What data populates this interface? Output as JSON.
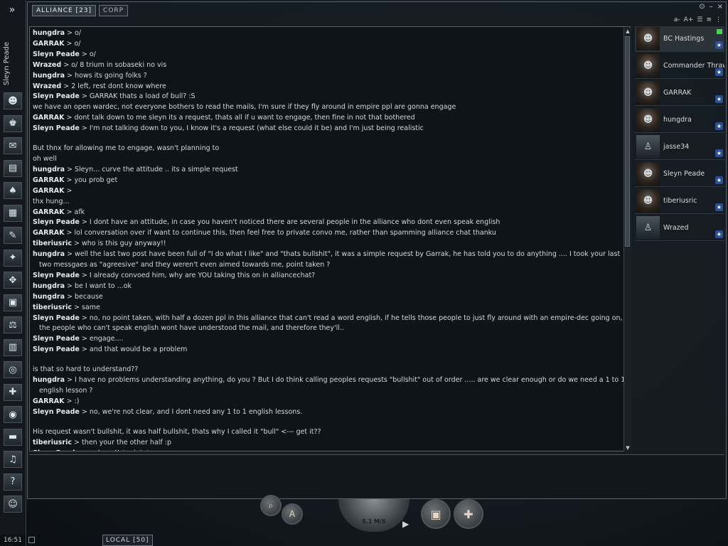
{
  "neocom": {
    "character_name": "Sleyn Peade",
    "clock": "16:51",
    "buttons": [
      {
        "name": "character-sheet-icon",
        "glyph": "☻"
      },
      {
        "name": "people-places-icon",
        "glyph": "♚"
      },
      {
        "name": "mail-icon",
        "glyph": "✉"
      },
      {
        "name": "notepad-icon",
        "glyph": "▤"
      },
      {
        "name": "cards-icon",
        "glyph": "♠"
      },
      {
        "name": "journal-icon",
        "glyph": "▦"
      },
      {
        "name": "contract-icon",
        "glyph": "✎"
      },
      {
        "name": "map-icon",
        "glyph": "✦"
      },
      {
        "name": "science-icon",
        "glyph": "✥"
      },
      {
        "name": "cargo-icon",
        "glyph": "▣"
      },
      {
        "name": "market-icon",
        "glyph": "⚖"
      },
      {
        "name": "calculator-icon",
        "glyph": "▥"
      },
      {
        "name": "help-lifebuoy-icon",
        "glyph": "◎"
      },
      {
        "name": "fitting-icon",
        "glyph": "✚"
      },
      {
        "name": "browser-icon",
        "glyph": "◉"
      },
      {
        "name": "book-icon",
        "glyph": "▬"
      },
      {
        "name": "audio-icon",
        "glyph": "♫"
      },
      {
        "name": "info-icon",
        "glyph": "?"
      },
      {
        "name": "avatar-icon",
        "glyph": "☺"
      }
    ]
  },
  "chat": {
    "tabs": [
      {
        "label": "ALLIANCE [23]",
        "active": true
      },
      {
        "label": "CORP",
        "active": false
      }
    ],
    "font_controls": [
      "a-",
      "A+"
    ],
    "messages": [
      {
        "sender": "hungdra",
        "text": "o/"
      },
      {
        "sender": "GARRAK",
        "text": "o/"
      },
      {
        "sender": "Sleyn Peade",
        "text": "o/"
      },
      {
        "sender": "Wrazed",
        "text": "o/ 8 trium in sobaseki no vis"
      },
      {
        "sender": "hungdra",
        "text": "hows its going folks ?"
      },
      {
        "sender": "Wrazed",
        "text": "2 left, rest dont know where"
      },
      {
        "sender": "Sleyn Peade",
        "text": "GARRAK thats a load of bull? :S"
      },
      {
        "sender": "",
        "text": "we have an open wardec, not everyone bothers to read the mails, I'm sure if they fly around in empire ppl are gonna engage"
      },
      {
        "sender": "GARRAK",
        "text": "dont talk down to me sleyn its a request, thats all if u want to engage, then fine in not that bothered"
      },
      {
        "sender": "Sleyn Peade",
        "text": "I'm not talking down to you, I know it's a request (what else could it be) and I'm just being realistic"
      },
      {
        "sender": "",
        "text": ""
      },
      {
        "sender": "",
        "text": "But thnx for allowing me to engage, wasn't planning to"
      },
      {
        "sender": "",
        "text": "oh well"
      },
      {
        "sender": "hungdra",
        "text": "Sleyn... curve the attitude .. its a simple request"
      },
      {
        "sender": "GARRAK",
        "text": "you prob get"
      },
      {
        "sender": "GARRAK",
        "text": ""
      },
      {
        "sender": "",
        "text": "thx hung..."
      },
      {
        "sender": "GARRAK",
        "text": "afk"
      },
      {
        "sender": "Sleyn Peade",
        "text": "I dont have an attitude, in case you haven't noticed there are several people in the alliance who dont even speak english"
      },
      {
        "sender": "GARRAK",
        "text": "lol conversation over if want to continue this, then feel free to private convo me, rather than spamming alliance chat thanku"
      },
      {
        "sender": "tiberiusric",
        "text": "who is this guy anyway!!"
      },
      {
        "sender": "hungdra",
        "text": "well the last two post have been full of \"I do what I like\" and \"thats bullshit\", it was a simple request by Garrak, he has told you to do anything .... I took your last two messgaes as \"agreesive\" and they weren't even aimed towards me, point taken ?"
      },
      {
        "sender": "Sleyn Peade",
        "text": "I already convoed him, why are YOU taking this on in alliancechat?"
      },
      {
        "sender": "hungdra",
        "text": "be I want to ...ok"
      },
      {
        "sender": "hungdra",
        "text": "because"
      },
      {
        "sender": "tiberiusric",
        "text": "same"
      },
      {
        "sender": "Sleyn Peade",
        "text": "no, no point taken, with half a dozen ppl in this alliance that can't read a word english, if he tells those people to just fly around with an empire-dec going on, the people who can't speak english wont have understood the mail, and therefore they'll.."
      },
      {
        "sender": "Sleyn Peade",
        "text": "engage...."
      },
      {
        "sender": "Sleyn Peade",
        "text": "and that would be a problem"
      },
      {
        "sender": "",
        "text": ""
      },
      {
        "sender": "",
        "text": "is that so hard to understand??"
      },
      {
        "sender": "hungdra",
        "text": "I have no problems understanding anything, do you ? But I do think calling peoples requests \"bullshit\" out of order ..... are we clear enough or do we need a 1 to 1 english lesson ?"
      },
      {
        "sender": "GARRAK",
        "text": ":)"
      },
      {
        "sender": "Sleyn Peade",
        "text": "no, we're not clear, and I dont need any 1 to 1 english lessons."
      },
      {
        "sender": "",
        "text": ""
      },
      {
        "sender": "",
        "text": "His request wasn't bullshit, it was half bullshit, thats why I called it \"bull\" <--- get it??"
      },
      {
        "sender": "tiberiusric",
        "text": "then your the other half :p"
      },
      {
        "sender": "Sleyn Peade",
        "text": "nol you!! *points*"
      }
    ],
    "members": [
      {
        "name": "BC Hastings",
        "icon": "portrait",
        "selected": true
      },
      {
        "name": "Commander Thrawn",
        "icon": "portrait",
        "selected": false
      },
      {
        "name": "GARRAK",
        "icon": "portrait",
        "selected": false
      },
      {
        "name": "hungdra",
        "icon": "portrait",
        "selected": false
      },
      {
        "name": "jasse34",
        "icon": "silhouette",
        "selected": false
      },
      {
        "name": "Sleyn Peade",
        "icon": "portrait",
        "selected": false
      },
      {
        "name": "tiberiusric",
        "icon": "portrait",
        "selected": false
      },
      {
        "name": "Wrazed",
        "icon": "silhouette",
        "selected": false
      }
    ],
    "input_value": ""
  },
  "hud": {
    "speed": "5.1 M/S",
    "local_tab": "LOCAL [50]",
    "accent_color": "#2d4f8e",
    "online_color": "#3fd94a"
  }
}
